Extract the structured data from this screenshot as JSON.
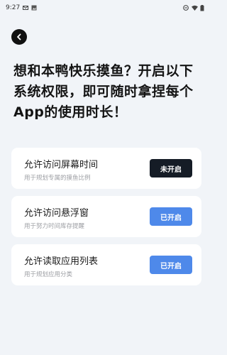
{
  "status_bar": {
    "time": "9:27",
    "left_icons": [
      "mail-icon",
      "image-icon"
    ],
    "right_icons": [
      "dnd-icon",
      "wifi-icon",
      "battery-icon"
    ]
  },
  "headline": {
    "line1": "想和本鸭快乐摸鱼？开启以下",
    "line2": "系统权限，即可随时拿捏每个",
    "line3": "App的使用时长！"
  },
  "permissions": [
    {
      "title": "允许访问屏幕时间",
      "subtitle": "用于规划专属的摸鱼比例",
      "button_label": "未开启",
      "state": "off"
    },
    {
      "title": "允许访问悬浮窗",
      "subtitle": "用于努力时间库存提醒",
      "button_label": "已开启",
      "state": "on"
    },
    {
      "title": "允许读取应用列表",
      "subtitle": "用于规划应用分类",
      "button_label": "已开启",
      "state": "on"
    }
  ],
  "colors": {
    "background": "#f1f4f8",
    "button_off": "#151c26",
    "button_on": "#4e89ea"
  }
}
